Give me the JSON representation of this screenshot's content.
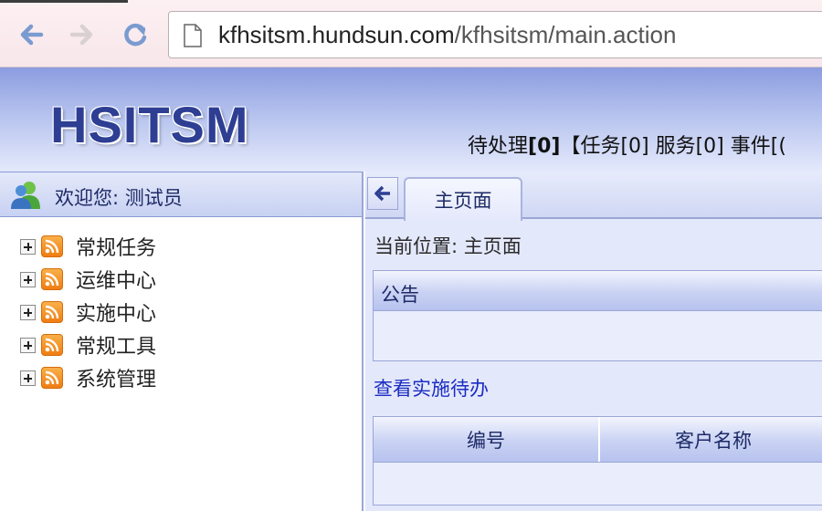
{
  "browser": {
    "url_host": "kfhsitsm.hundsun.com",
    "url_path": "/kfhsitsm/main.action"
  },
  "header": {
    "logo": "HSITSM",
    "pending_label": "待处理",
    "pending_count": "[0]",
    "pending_rest": "【任务[0] 服务[0] 事件[("
  },
  "sidebar": {
    "welcome": "欢迎您: 测试员",
    "items": [
      {
        "label": "常规任务"
      },
      {
        "label": "运维中心"
      },
      {
        "label": "实施中心"
      },
      {
        "label": "常规工具"
      },
      {
        "label": "系统管理"
      }
    ]
  },
  "main": {
    "tab_home": "主页面",
    "breadcrumb": "当前位置: 主页面",
    "notice_title": "公告",
    "todo_link": "查看实施待办",
    "table_columns": [
      "编号",
      "客户名称"
    ]
  },
  "colors": {
    "header_top": "#8b9ce0",
    "logo": "#2d3e93",
    "link": "#1a2cc2",
    "rss": "#ef7d12"
  }
}
